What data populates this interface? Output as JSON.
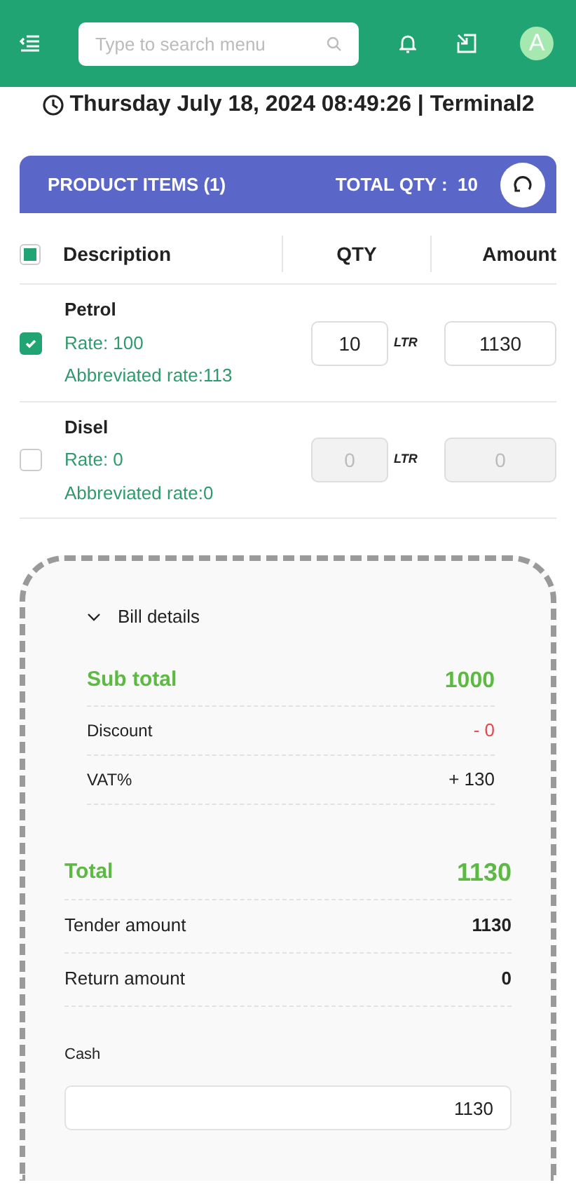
{
  "header": {
    "search": {
      "placeholder": "Type to search menu"
    },
    "avatar": "A"
  },
  "datetime": "Thursday July 18, 2024 08:49:26 | Terminal2",
  "product_bar": {
    "title": "PRODUCT ITEMS (1)",
    "total_qty": "TOTAL QTY :  10"
  },
  "table": {
    "select_all_partial": true,
    "columns": [
      "Description",
      "QTY",
      "Amount"
    ],
    "rows": [
      {
        "name": "Petrol",
        "rate": "Rate: 100",
        "abbreviated_rate": "Abbreviated rate:113",
        "qty": "10",
        "unit": "LTR",
        "amount": "1130",
        "checked": true,
        "disabled": false
      },
      {
        "name": "Disel",
        "rate": "Rate: 0",
        "abbreviated_rate": "Abbreviated rate:0",
        "qty": "0",
        "unit": "LTR",
        "amount": "0",
        "checked": false,
        "disabled": true
      }
    ]
  },
  "bill": {
    "toggle": "Bill details",
    "expanded": true,
    "details": [
      {
        "kind": "subtotal",
        "label": "Sub total",
        "value": "1000"
      },
      {
        "kind": "discount",
        "label": "Discount",
        "value": "- 0"
      },
      {
        "kind": "plain",
        "label": "VAT%",
        "value": "+ 130"
      }
    ],
    "summary": [
      {
        "kind": "total",
        "label": "Total",
        "value": "1130"
      },
      {
        "kind": "plain",
        "label": "Tender amount",
        "value": "1130"
      },
      {
        "kind": "plain",
        "label": "Return amount",
        "value": "0"
      }
    ],
    "cash": {
      "label": "Cash",
      "value": "1130"
    }
  }
}
